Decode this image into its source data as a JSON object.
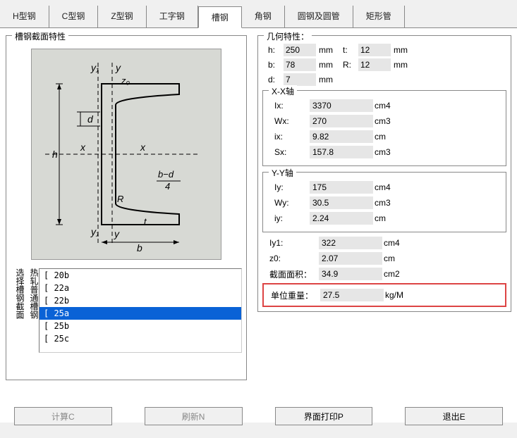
{
  "tabs": [
    "H型钢",
    "C型钢",
    "Z型钢",
    "工字钢",
    "槽钢",
    "角钢",
    "圆钢及圆管",
    "矩形管"
  ],
  "active_tab": 4,
  "left_title": "槽钢截面特性",
  "selector_label1": "选择槽钢截面",
  "selector_label2": "热轧普通槽钢",
  "list_items": [
    "[ 20b",
    "[ 22a",
    "[ 22b",
    "[ 25a",
    "[ 25b",
    "[ 25c"
  ],
  "list_selected": 3,
  "geom_title": "几何特性：",
  "geom_rows": [
    {
      "l": "h:",
      "v": "250",
      "u": "mm",
      "l2": "t:",
      "v2": "12",
      "u2": "mm"
    },
    {
      "l": "b:",
      "v": "78",
      "u": "mm",
      "l2": "R:",
      "v2": "12",
      "u2": "mm"
    },
    {
      "l": "d:",
      "v": "7",
      "u": "mm"
    }
  ],
  "xx_title": "X-X轴",
  "xx": [
    {
      "l": "Ix:",
      "v": "3370",
      "u": "cm4"
    },
    {
      "l": "Wx:",
      "v": "270",
      "u": "cm3"
    },
    {
      "l": "ix:",
      "v": "9.82",
      "u": "cm"
    },
    {
      "l": "Sx:",
      "v": "157.8",
      "u": "cm3"
    }
  ],
  "yy_title": "Y-Y轴",
  "yy": [
    {
      "l": "Iy:",
      "v": "175",
      "u": "cm4"
    },
    {
      "l": "Wy:",
      "v": "30.5",
      "u": "cm3"
    },
    {
      "l": "iy:",
      "v": "2.24",
      "u": "cm"
    }
  ],
  "extra": [
    {
      "l": "Iy1:",
      "v": "322",
      "u": "cm4"
    },
    {
      "l": "z0:",
      "v": "2.07",
      "u": "cm"
    },
    {
      "l": "截面面积：",
      "v": "34.9",
      "u": "cm2"
    }
  ],
  "highlight": {
    "l": "单位重量：",
    "v": "27.5",
    "u": "kg/M"
  },
  "buttons": [
    "计算C",
    "刷新N",
    "界面打印P",
    "退出E"
  ],
  "diagram_labels": {
    "y1": "y₁",
    "y": "y",
    "z0": "z₀",
    "d": "d",
    "x": "x",
    "h": "h",
    "bd4": "b−d",
    "bd4b": "4",
    "R": "R",
    "t": "t",
    "b": "b"
  }
}
